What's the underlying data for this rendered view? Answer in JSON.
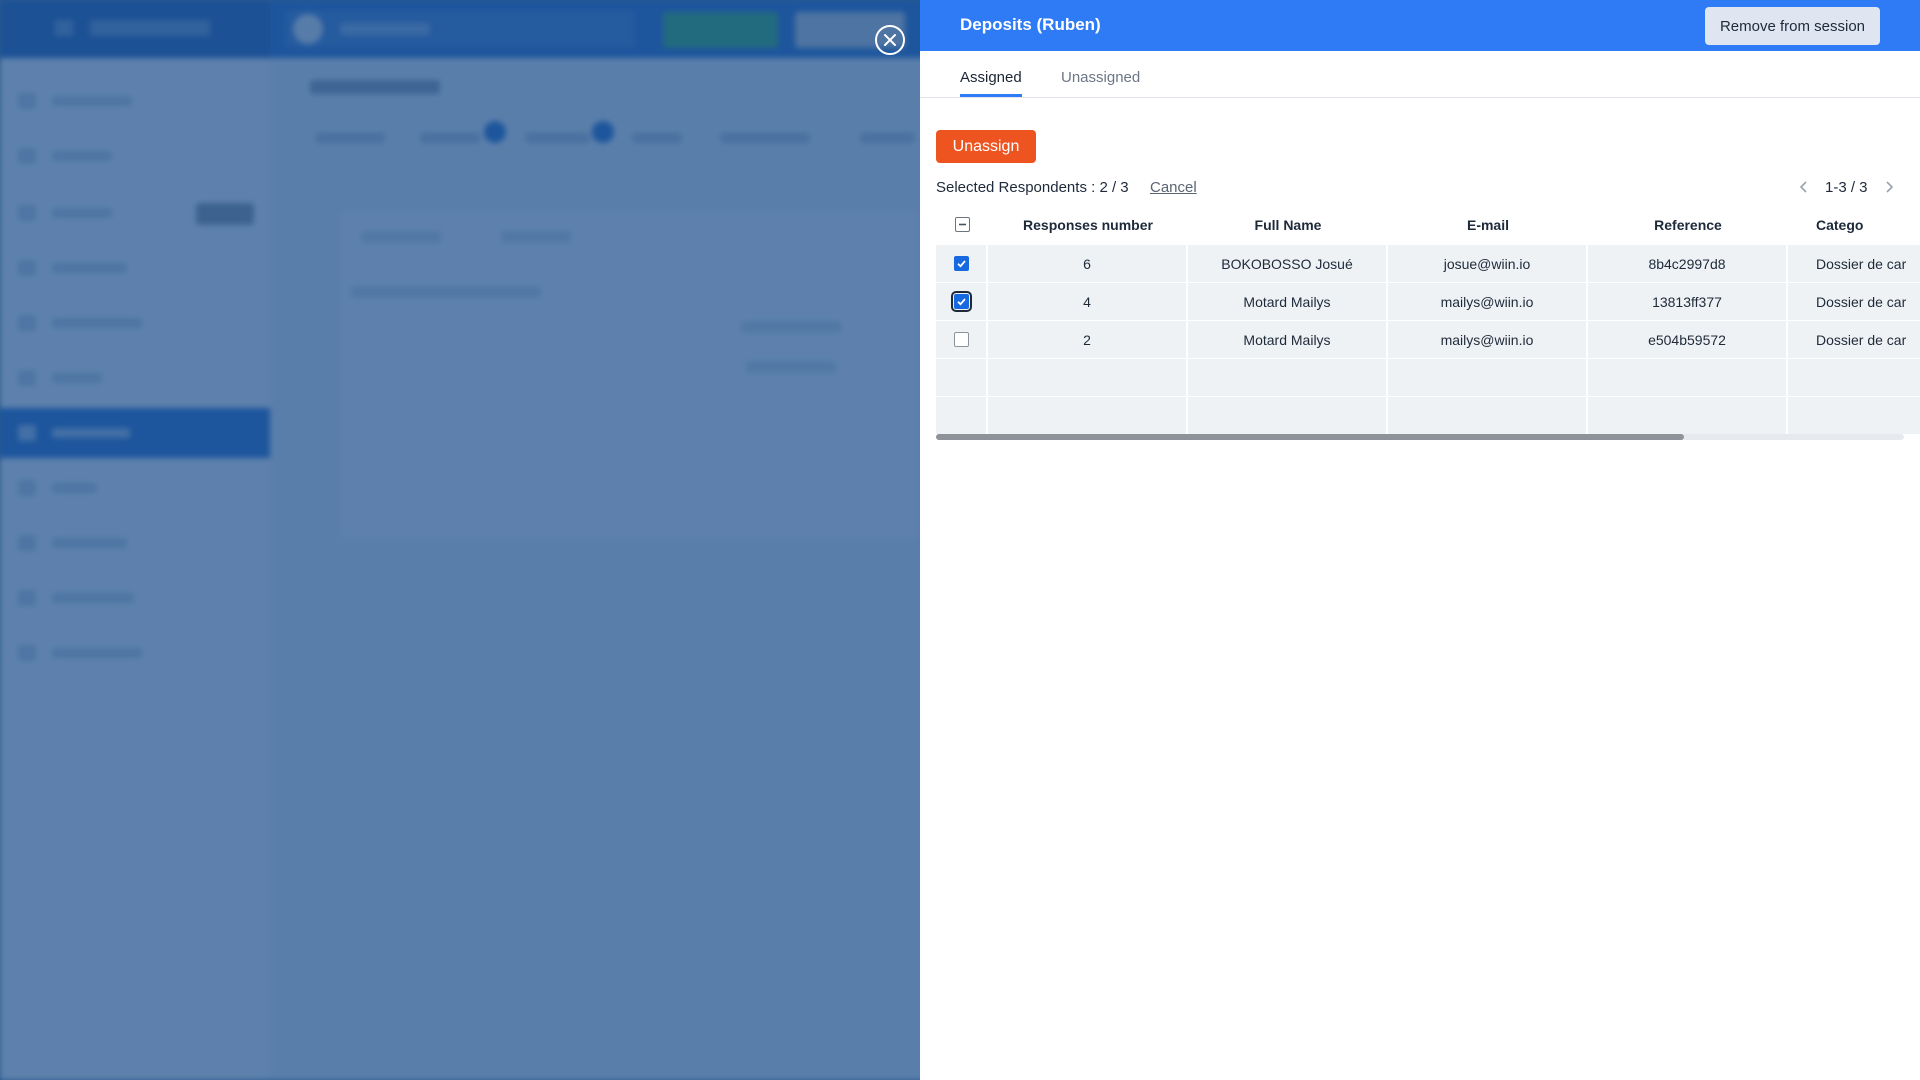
{
  "drawer": {
    "title": "Deposits (Ruben)",
    "remove_button": "Remove from session",
    "tabs": [
      {
        "label": "Assigned",
        "active": true
      },
      {
        "label": "Unassigned",
        "active": false
      }
    ],
    "unassign_button": "Unassign",
    "selection": {
      "label": "Selected Respondents : 2 / 3",
      "cancel": "Cancel"
    },
    "pagination": {
      "text": "1-3 / 3"
    },
    "table": {
      "columns": [
        "Responses number",
        "Full Name",
        "E-mail",
        "Reference",
        "Catego"
      ],
      "rows": [
        {
          "checked": true,
          "responses": "6",
          "full_name": "BOKOBOSSO Josué",
          "email": "josue@wiin.io",
          "reference": "8b4c2997d8",
          "category": "Dossier de car"
        },
        {
          "checked": true,
          "responses": "4",
          "full_name": "Motard Mailys",
          "email": "mailys@wiin.io",
          "reference": "13813ff377",
          "category": "Dossier de car"
        },
        {
          "checked": false,
          "responses": "2",
          "full_name": "Motard Mailys",
          "email": "mailys@wiin.io",
          "reference": "e504b59572",
          "category": "Dossier de car"
        }
      ]
    }
  },
  "colors": {
    "header_blue": "#2f7bf5",
    "unassign_orange": "#ee5420",
    "checkbox_blue": "#1769e0"
  },
  "icons": {
    "close": "close-circle-icon",
    "prev": "chevron-left-icon",
    "next": "chevron-right-icon"
  }
}
